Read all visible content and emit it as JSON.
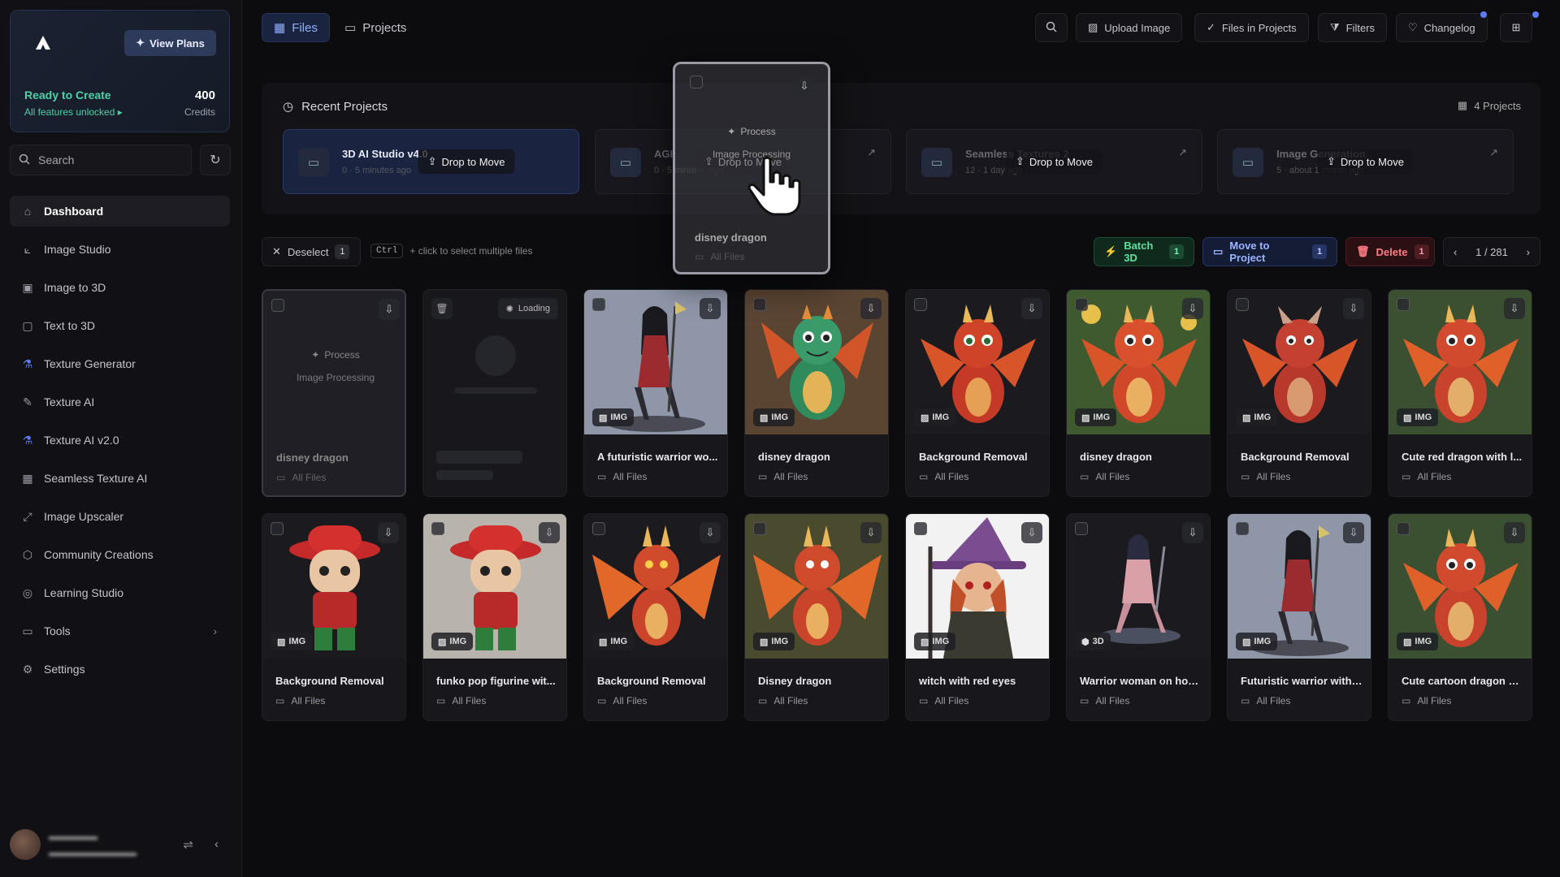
{
  "sidebar": {
    "view_plans": "View Plans",
    "ready": "Ready to Create",
    "unlocked": "All features unlocked",
    "credits_value": "400",
    "credits_label": "Credits",
    "search_placeholder": "Search",
    "nav": [
      {
        "label": "Dashboard",
        "icon": "home-icon"
      },
      {
        "label": "Image Studio",
        "icon": "image-studio-icon"
      },
      {
        "label": "Image to 3D",
        "icon": "image-to-3d-icon"
      },
      {
        "label": "Text to 3D",
        "icon": "text-to-3d-icon"
      },
      {
        "label": "Texture Generator",
        "icon": "texture-generator-icon"
      },
      {
        "label": "Texture AI",
        "icon": "texture-ai-icon"
      },
      {
        "label": "Texture AI v2.0",
        "icon": "texture-ai-v2-icon"
      },
      {
        "label": "Seamless Texture AI",
        "icon": "seamless-texture-icon"
      },
      {
        "label": "Image Upscaler",
        "icon": "upscaler-icon"
      },
      {
        "label": "Community Creations",
        "icon": "community-icon"
      },
      {
        "label": "Learning Studio",
        "icon": "learning-icon"
      },
      {
        "label": "Tools",
        "icon": "tools-icon"
      },
      {
        "label": "Settings",
        "icon": "settings-icon"
      }
    ]
  },
  "topbar": {
    "tab_files": "Files",
    "tab_projects": "Projects",
    "upload": "Upload Image",
    "files_in_projects": "Files in Projects",
    "filters": "Filters",
    "changelog": "Changelog"
  },
  "recent": {
    "title": "Recent Projects",
    "count": "4 Projects",
    "drop_label": "Drop to Move",
    "projects": [
      {
        "name": "3D AI Studio v4.0",
        "meta": "0 · 5 minutes ago"
      },
      {
        "name": "AGI",
        "meta": "0 · 5 minutes ago"
      },
      {
        "name": "Seamless Textures 2",
        "meta": "12 · 1 day ago"
      },
      {
        "name": "Image Generation",
        "meta": "5 · about 1 month ago"
      }
    ]
  },
  "toolbar": {
    "deselect": "Deselect",
    "deselect_count": "1",
    "ctrl": "Ctrl",
    "hint": "+ click to select multiple files",
    "batch": "Batch 3D",
    "batch_count": "1",
    "move": "Move to Project",
    "move_count": "1",
    "delete": "Delete",
    "delete_count": "1",
    "page": "1 / 281"
  },
  "processing": {
    "btn": "Process",
    "sub": "Image Processing",
    "title": "disney dragon",
    "folder": "All Files"
  },
  "loading_label": "Loading",
  "cards": [
    {
      "title": "A futuristic warrior wo...",
      "folder": "All Files",
      "type": "IMG"
    },
    {
      "title": "disney dragon",
      "folder": "All Files",
      "type": "IMG"
    },
    {
      "title": "Background Removal",
      "folder": "All Files",
      "type": "IMG"
    },
    {
      "title": "disney dragon",
      "folder": "All Files",
      "type": "IMG"
    },
    {
      "title": "Background Removal",
      "folder": "All Files",
      "type": "IMG"
    },
    {
      "title": "Cute red dragon with l...",
      "folder": "All Files",
      "type": "IMG"
    },
    {
      "title": "Background Removal",
      "folder": "All Files",
      "type": "IMG"
    },
    {
      "title": "funko pop figurine wit...",
      "folder": "All Files",
      "type": "IMG"
    },
    {
      "title": "Background Removal",
      "folder": "All Files",
      "type": "IMG"
    },
    {
      "title": "Disney dragon",
      "folder": "All Files",
      "type": "IMG"
    },
    {
      "title": "witch with red eyes",
      "folder": "All Files",
      "type": "IMG"
    },
    {
      "title": "Warrior woman on hov...",
      "folder": "All Files",
      "type": "3D"
    },
    {
      "title": "Futuristic warrior with ...",
      "folder": "All Files",
      "type": "IMG"
    },
    {
      "title": "Cute cartoon dragon w...",
      "folder": "All Files",
      "type": "IMG"
    }
  ],
  "colors": {
    "accent": "#5b7cf7",
    "success": "#4fd1a7",
    "danger": "#ff7a85"
  }
}
